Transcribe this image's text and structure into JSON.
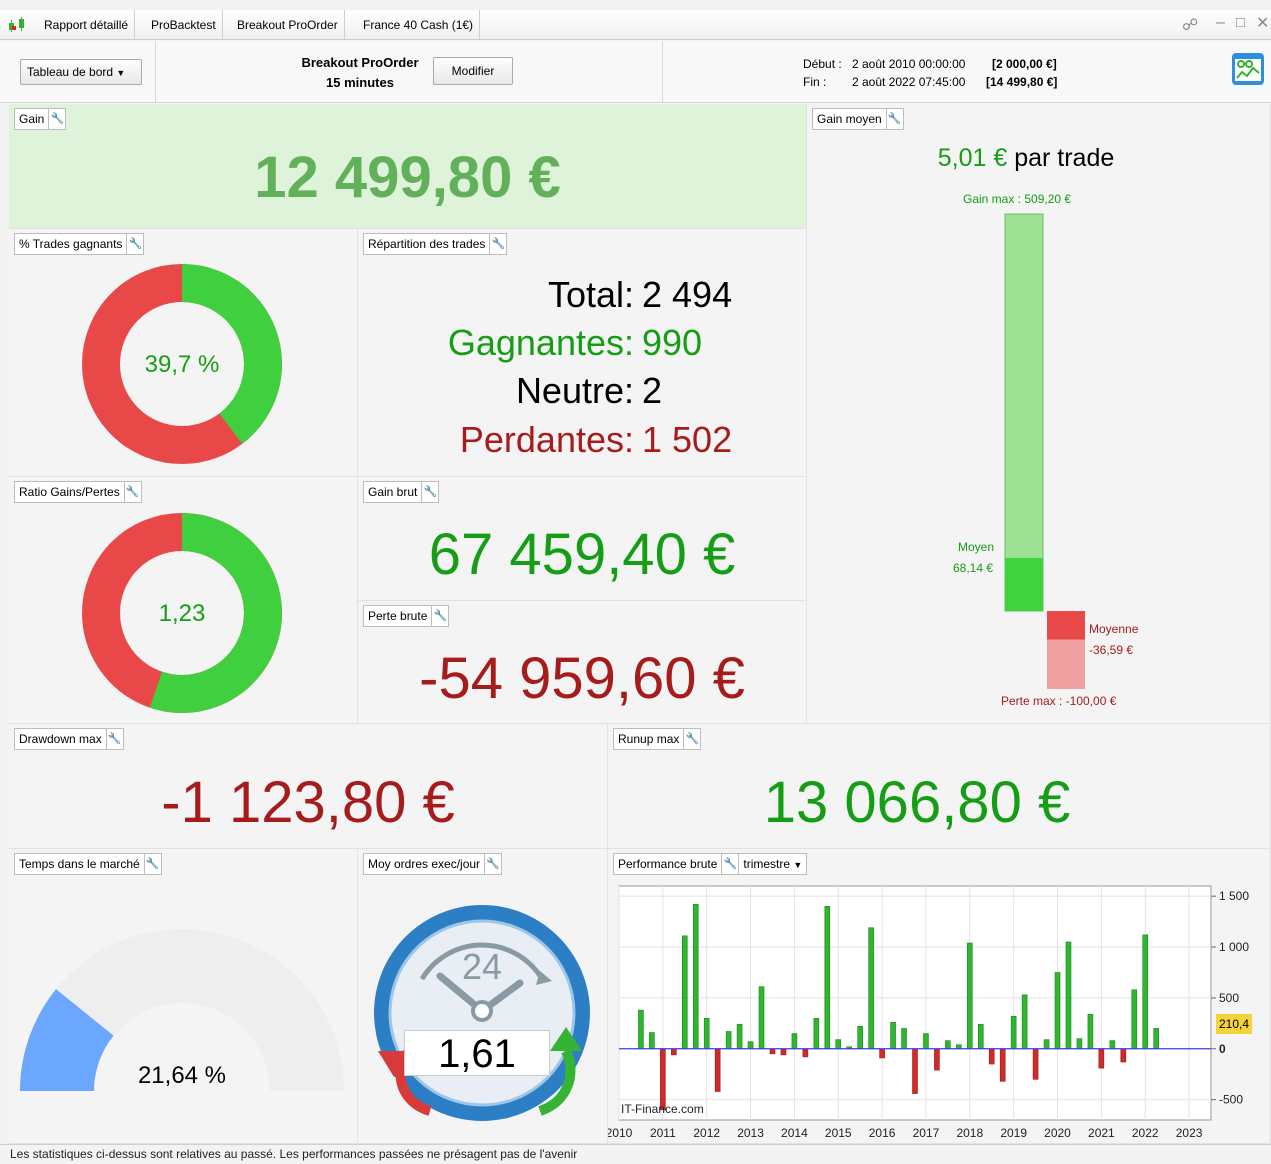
{
  "titlebar": {
    "tabs": [
      "Rapport détaillé",
      "ProBacktest",
      "Breakout ProOrder",
      "France 40 Cash (1€)"
    ],
    "window_buttons": [
      "share-icon",
      "minimize-icon",
      "maximize-icon",
      "close-icon"
    ]
  },
  "controls": {
    "dashboard_select": "Tableau de bord",
    "strategy_name": "Breakout ProOrder",
    "timeframe": "15 minutes",
    "modify_label": "Modifier",
    "start_label": "Début :",
    "start_date": "2 août 2010 00:00:00",
    "start_value": "[2 000,00 €]",
    "end_label": "Fin :",
    "end_date": "2 août 2022 07:45:00",
    "end_value": "[14 499,80 €]"
  },
  "gain": {
    "title": "Gain",
    "value": "12 499,80 €"
  },
  "gain_moyen": {
    "title": "Gain moyen",
    "value": "5,01 €",
    "suffix": "par trade",
    "gain_max_label": "Gain max : 509,20 €",
    "avg_gain_label": "Moyen",
    "avg_gain_value": "68,14 €",
    "avg_loss_label": "Moyenne",
    "avg_loss_value": "-36,59 €",
    "loss_max_label": "Perte max : -100,00 €",
    "gain_max": 509.2,
    "avg_gain": 68.14,
    "avg_loss": -36.59,
    "loss_max": -100.0
  },
  "winning_trades": {
    "title": "% Trades gagnants",
    "value": "39,7 %",
    "fraction": 0.397
  },
  "repartition": {
    "title": "Répartition des trades",
    "rows": [
      {
        "label": "Total",
        "value": "2 494"
      },
      {
        "label": "Gagnantes",
        "value": "990"
      },
      {
        "label": "Neutre",
        "value": "2"
      },
      {
        "label": "Perdantes",
        "value": "1 502"
      }
    ]
  },
  "ratio": {
    "title": "Ratio Gains/Pertes",
    "value": "1,23",
    "fraction": 0.552
  },
  "gain_brut": {
    "title": "Gain brut",
    "value": "67 459,40 €"
  },
  "perte_brute": {
    "title": "Perte brute",
    "value": "-54 959,60 €"
  },
  "drawdown": {
    "title": "Drawdown max",
    "value": "-1 123,80 €"
  },
  "runup": {
    "title": "Runup max",
    "value": "13 066,80 €"
  },
  "time_in_market": {
    "title": "Temps dans le marché",
    "value": "21,64 %",
    "fraction": 0.2164
  },
  "orders_per_day": {
    "title": "Moy ordres exec/jour",
    "value": "1,61",
    "clock_label": "24"
  },
  "performance": {
    "title": "Performance brute",
    "period_select": "trimestre",
    "watermark": "IT-Finance.com",
    "current_value_label": "210,4",
    "colors": {
      "positive": "#2fb52f",
      "negative": "#d02a2a",
      "zero_line": "#3a3af0"
    }
  },
  "chart_data": {
    "type": "bar",
    "title": "Performance brute",
    "period": "trimestre",
    "x_tick_labels": [
      "2010",
      "2011",
      "2012",
      "2013",
      "2014",
      "2015",
      "2016",
      "2017",
      "2018",
      "2019",
      "2020",
      "2021",
      "2022",
      "2023"
    ],
    "y_tick_labels": [
      "1 500",
      "1 000",
      "500",
      "0",
      "-500"
    ],
    "y_ticks": [
      1500,
      1000,
      500,
      0,
      -500
    ],
    "ylim": [
      -700,
      1600
    ],
    "xlim": [
      2010.0,
      2023.5
    ],
    "grid": true,
    "last_value": 210.4,
    "series": [
      {
        "x": [
          2010.5,
          2010.75,
          2011.0,
          2011.25,
          2011.5,
          2011.75,
          2012.0,
          2012.25,
          2012.5,
          2012.75,
          2013.0,
          2013.25,
          2013.5,
          2013.75,
          2014.0,
          2014.25,
          2014.5,
          2014.75,
          2015.0,
          2015.25,
          2015.5,
          2015.75,
          2016.0,
          2016.25,
          2016.5,
          2016.75,
          2017.0,
          2017.25,
          2017.5,
          2017.75,
          2018.0,
          2018.25,
          2018.5,
          2018.75,
          2019.0,
          2019.25,
          2019.5,
          2019.75,
          2020.0,
          2020.25,
          2020.5,
          2020.75,
          2021.0,
          2021.25,
          2021.5,
          2021.75,
          2022.0,
          2022.25
        ],
        "values": [
          380,
          160,
          -600,
          -60,
          1110,
          1420,
          300,
          -420,
          170,
          240,
          70,
          610,
          -50,
          -60,
          150,
          -80,
          300,
          1400,
          90,
          20,
          220,
          1190,
          -90,
          260,
          200,
          -440,
          150,
          -210,
          80,
          40,
          1040,
          240,
          -150,
          -320,
          320,
          530,
          -300,
          90,
          750,
          1050,
          100,
          340,
          -190,
          80,
          -130,
          580,
          1120,
          200
        ]
      }
    ]
  }
}
